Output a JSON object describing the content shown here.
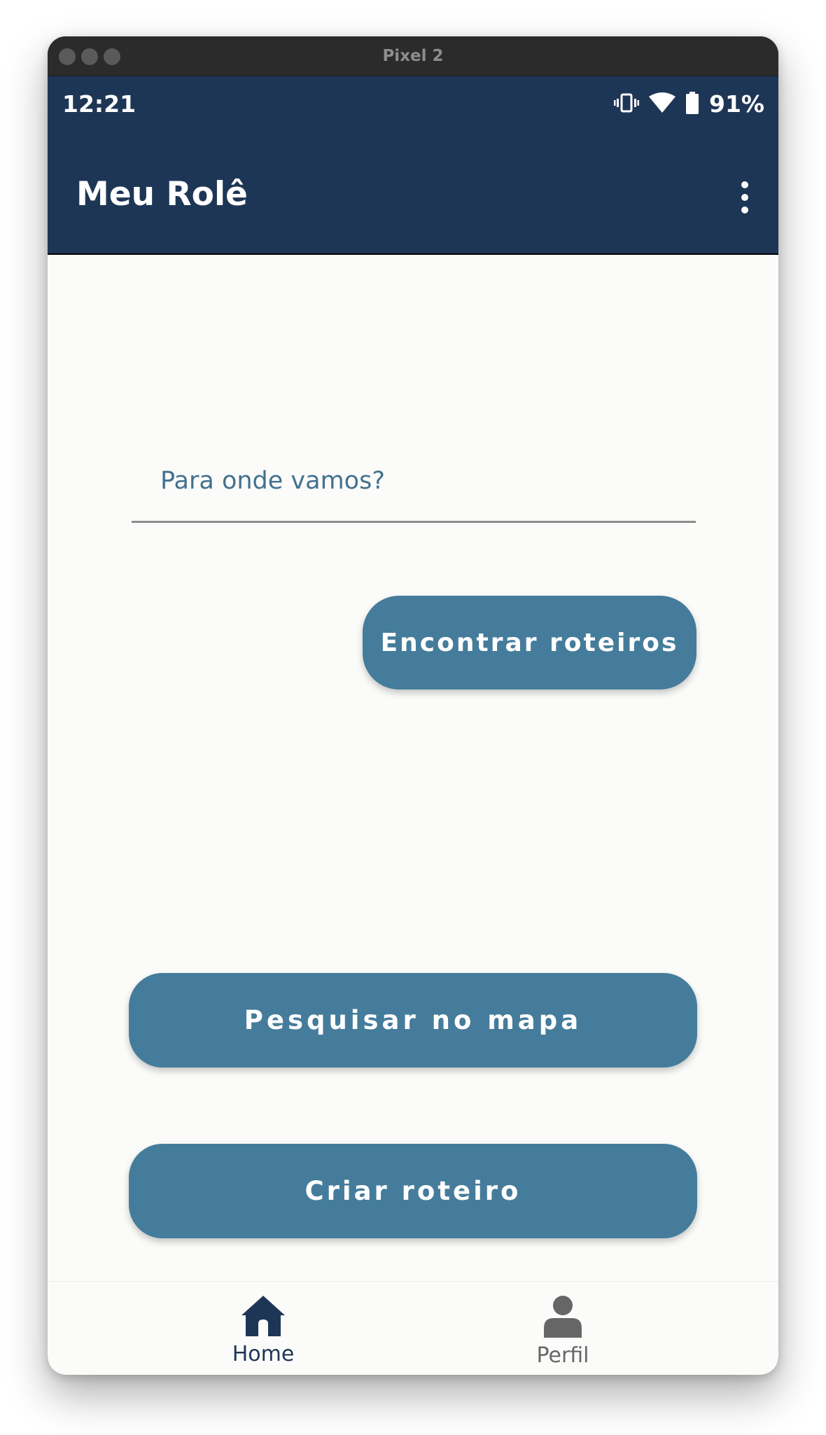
{
  "window": {
    "title": "Pixel 2"
  },
  "status_bar": {
    "time": "12:21",
    "battery_percent": "91%",
    "icons": [
      "vibrate-icon",
      "wifi-icon",
      "battery-icon"
    ]
  },
  "app_bar": {
    "title": "Meu Rolê",
    "menu_icon": "more-vert-icon"
  },
  "search": {
    "placeholder": "Para onde vamos?",
    "value": ""
  },
  "buttons": {
    "find_routes": "Encontrar roteiros",
    "search_map": "Pesquisar no mapa",
    "create_route": "Criar roteiro"
  },
  "bottom_nav": {
    "items": [
      {
        "label": "Home",
        "icon": "home-icon",
        "active": true
      },
      {
        "label": "Perfil",
        "icon": "person-icon",
        "active": false
      }
    ]
  },
  "colors": {
    "primary_dark": "#1e3656",
    "button": "#457c9b",
    "background": "#fbfcfa",
    "inactive": "#666666"
  }
}
